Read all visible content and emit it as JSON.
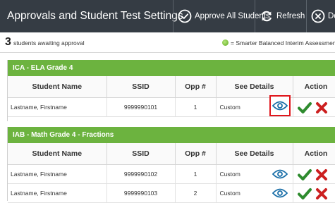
{
  "header": {
    "title": "Approvals and Student Test Settings",
    "approve_all_label": "Approve All Students",
    "refresh_label": "Refresh",
    "done_label": "Don"
  },
  "summary": {
    "count": "3",
    "awaiting_label": "students awaiting approval",
    "legend_label": "= Smarter Balanced Interim Assessments"
  },
  "columns": {
    "name": "Student Name",
    "ssid": "SSID",
    "opp": "Opp #",
    "details": "See Details",
    "action": "Action"
  },
  "sections": [
    {
      "title": "ICA - ELA Grade 4",
      "rows": [
        {
          "name": "Lastname, Firstname",
          "ssid": "9999990101",
          "opp": "1",
          "details": "Custom"
        }
      ]
    },
    {
      "title": "IAB - Math Grade 4 - Fractions",
      "rows": [
        {
          "name": "Lastname, Firstname",
          "ssid": "9999990102",
          "opp": "1",
          "details": "Custom"
        },
        {
          "name": "Lastname, Firstname",
          "ssid": "9999990103",
          "opp": "2",
          "details": "Custom"
        }
      ]
    }
  ],
  "icons": {
    "approve_all": "check-circle-icon",
    "refresh": "refresh-icon",
    "done": "close-circle-icon",
    "view": "eye-icon",
    "approve": "check-icon",
    "deny": "x-icon"
  },
  "colors": {
    "topbar": "#353c44",
    "section_header": "#6cb33f",
    "approve": "#2e8b2e",
    "deny": "#cc1f1f",
    "eye": "#1a6fa8",
    "highlight": "#e0161c"
  }
}
